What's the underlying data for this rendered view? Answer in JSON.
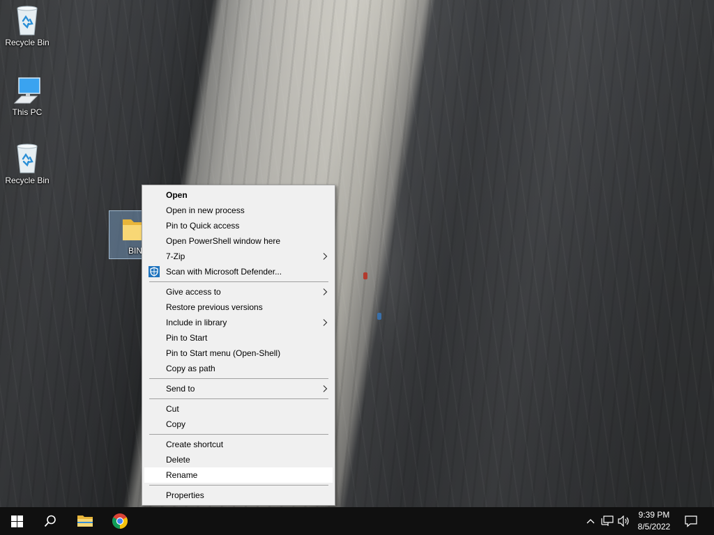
{
  "desktop": {
    "icons": [
      {
        "label": "Recycle Bin",
        "icon": "recycle-bin-icon"
      },
      {
        "label": "This PC",
        "icon": "this-pc-icon"
      },
      {
        "label": "Recycle Bin",
        "icon": "recycle-bin-icon"
      },
      {
        "label": "BIN",
        "icon": "folder-icon"
      }
    ]
  },
  "context_menu": {
    "groups": [
      [
        {
          "label": "Open",
          "bold": true
        },
        {
          "label": "Open in new process"
        },
        {
          "label": "Pin to Quick access"
        },
        {
          "label": "Open PowerShell window here"
        },
        {
          "label": "7-Zip",
          "submenu": true
        },
        {
          "label": "Scan with Microsoft Defender...",
          "icon": "defender-shield-icon"
        }
      ],
      [
        {
          "label": "Give access to",
          "submenu": true
        },
        {
          "label": "Restore previous versions"
        },
        {
          "label": "Include in library",
          "submenu": true
        },
        {
          "label": "Pin to Start"
        },
        {
          "label": "Pin to Start menu (Open-Shell)"
        },
        {
          "label": "Copy as path"
        }
      ],
      [
        {
          "label": "Send to",
          "submenu": true
        }
      ],
      [
        {
          "label": "Cut"
        },
        {
          "label": "Copy"
        }
      ],
      [
        {
          "label": "Create shortcut"
        },
        {
          "label": "Delete"
        },
        {
          "label": "Rename",
          "highlighted": true
        }
      ],
      [
        {
          "label": "Properties"
        }
      ]
    ]
  },
  "taskbar": {
    "buttons": [
      {
        "name": "start-button",
        "icon": "windows-logo-icon"
      },
      {
        "name": "search-button",
        "icon": "search-icon"
      },
      {
        "name": "file-explorer-button",
        "icon": "folder-icon"
      },
      {
        "name": "chrome-button",
        "icon": "chrome-icon"
      }
    ],
    "tray": {
      "icons": [
        "chevron-up-icon",
        "network-icon",
        "volume-icon"
      ],
      "time": "9:39 PM",
      "date": "8/5/2022",
      "notification_icon": "notification-icon"
    }
  },
  "colors": {
    "taskbar": "#101010",
    "menu_background": "#f0f0f0",
    "menu_highlight": "#ffffff",
    "selection": "#99ccff"
  }
}
